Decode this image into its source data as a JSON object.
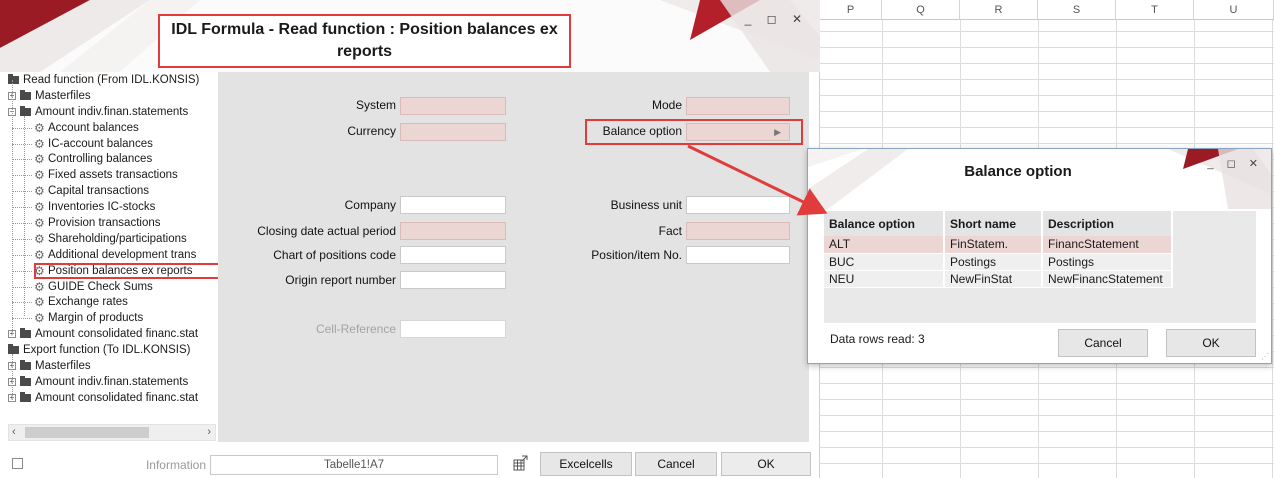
{
  "excel": {
    "columns": [
      "P",
      "Q",
      "R",
      "S",
      "T",
      "U"
    ]
  },
  "window": {
    "title": "IDL Formula - Read function : Position balances ex reports",
    "controls": "_ ◻ ✕"
  },
  "tree": {
    "items": [
      {
        "label": "Read function (From IDL.KONSIS)",
        "kind": "folder",
        "level": 0,
        "expander": ""
      },
      {
        "label": "Masterfiles",
        "kind": "folder",
        "level": 1,
        "expander": "+"
      },
      {
        "label": "Amount indiv.finan.statements",
        "kind": "folder",
        "level": 1,
        "expander": "−"
      },
      {
        "label": "Account balances",
        "kind": "gear",
        "level": 2,
        "expander": ""
      },
      {
        "label": "IC-account balances",
        "kind": "gear",
        "level": 2,
        "expander": ""
      },
      {
        "label": "Controlling balances",
        "kind": "gear",
        "level": 2,
        "expander": ""
      },
      {
        "label": "Fixed assets transactions",
        "kind": "gear",
        "level": 2,
        "expander": ""
      },
      {
        "label": "Capital transactions",
        "kind": "gear",
        "level": 2,
        "expander": ""
      },
      {
        "label": "Inventories IC-stocks",
        "kind": "gear",
        "level": 2,
        "expander": ""
      },
      {
        "label": "Provision transactions",
        "kind": "gear",
        "level": 2,
        "expander": ""
      },
      {
        "label": "Shareholding/participations",
        "kind": "gear",
        "level": 2,
        "expander": ""
      },
      {
        "label": "Additional development trans",
        "kind": "gear",
        "level": 2,
        "expander": ""
      },
      {
        "label": "Position balances ex reports",
        "kind": "gear",
        "level": 2,
        "expander": "",
        "selected": true
      },
      {
        "label": "GUIDE Check Sums",
        "kind": "gear",
        "level": 2,
        "expander": ""
      },
      {
        "label": "Exchange rates",
        "kind": "gear",
        "level": 2,
        "expander": ""
      },
      {
        "label": "Margin of products",
        "kind": "gear",
        "level": 2,
        "expander": ""
      },
      {
        "label": "Amount consolidated financ.stat",
        "kind": "folder",
        "level": 1,
        "expander": "+"
      },
      {
        "label": "Export function (To IDL.KONSIS)",
        "kind": "folder",
        "level": 0,
        "expander": ""
      },
      {
        "label": "Masterfiles",
        "kind": "folder",
        "level": 1,
        "expander": "+"
      },
      {
        "label": "Amount indiv.finan.statements",
        "kind": "folder",
        "level": 1,
        "expander": "+"
      },
      {
        "label": "Amount consolidated financ.stat",
        "kind": "folder",
        "level": 1,
        "expander": "+"
      }
    ],
    "scroll_left": "‹",
    "scroll_right": "›"
  },
  "form": {
    "system_label": "System",
    "currency_label": "Currency",
    "mode_label": "Mode",
    "balance_option_label": "Balance option",
    "company_label": "Company",
    "closing_date_label": "Closing date actual period",
    "chart_label": "Chart of positions code",
    "origin_label": "Origin report number",
    "business_unit_label": "Business unit",
    "fact_label": "Fact",
    "position_label": "Position/item No.",
    "cell_reference_label": "Cell-Reference",
    "system_value": "",
    "currency_value": "",
    "mode_value": "",
    "balance_option_value": "",
    "company_value": "",
    "closing_date_value": "",
    "chart_value": "",
    "origin_value": "",
    "business_unit_value": "",
    "fact_value": "",
    "position_value": "",
    "cell_reference_value": ""
  },
  "bottom": {
    "information_label": "Information",
    "information_value": "Tabelle1!A7",
    "excelcells_label": "Excelcells",
    "cancel_label": "Cancel",
    "ok_label": "OK"
  },
  "popup": {
    "title": "Balance option",
    "controls": "_ ◻ ✕",
    "headers": [
      "Balance option",
      "Short name",
      "Description"
    ],
    "rows": [
      [
        "ALT",
        "FinStatem.",
        "FinancStatement"
      ],
      [
        "BUC",
        "Postings",
        "Postings"
      ],
      [
        "NEU",
        "NewFinStat",
        "NewFinancStatement"
      ]
    ],
    "status": "Data rows read: 3",
    "cancel_label": "Cancel",
    "ok_label": "OK"
  },
  "colors": {
    "highlight_red": "#e03c3c",
    "banner_red": "#9b1b24",
    "required_pink": "#ecd6d3",
    "panel_gray": "#e3e3e3"
  }
}
